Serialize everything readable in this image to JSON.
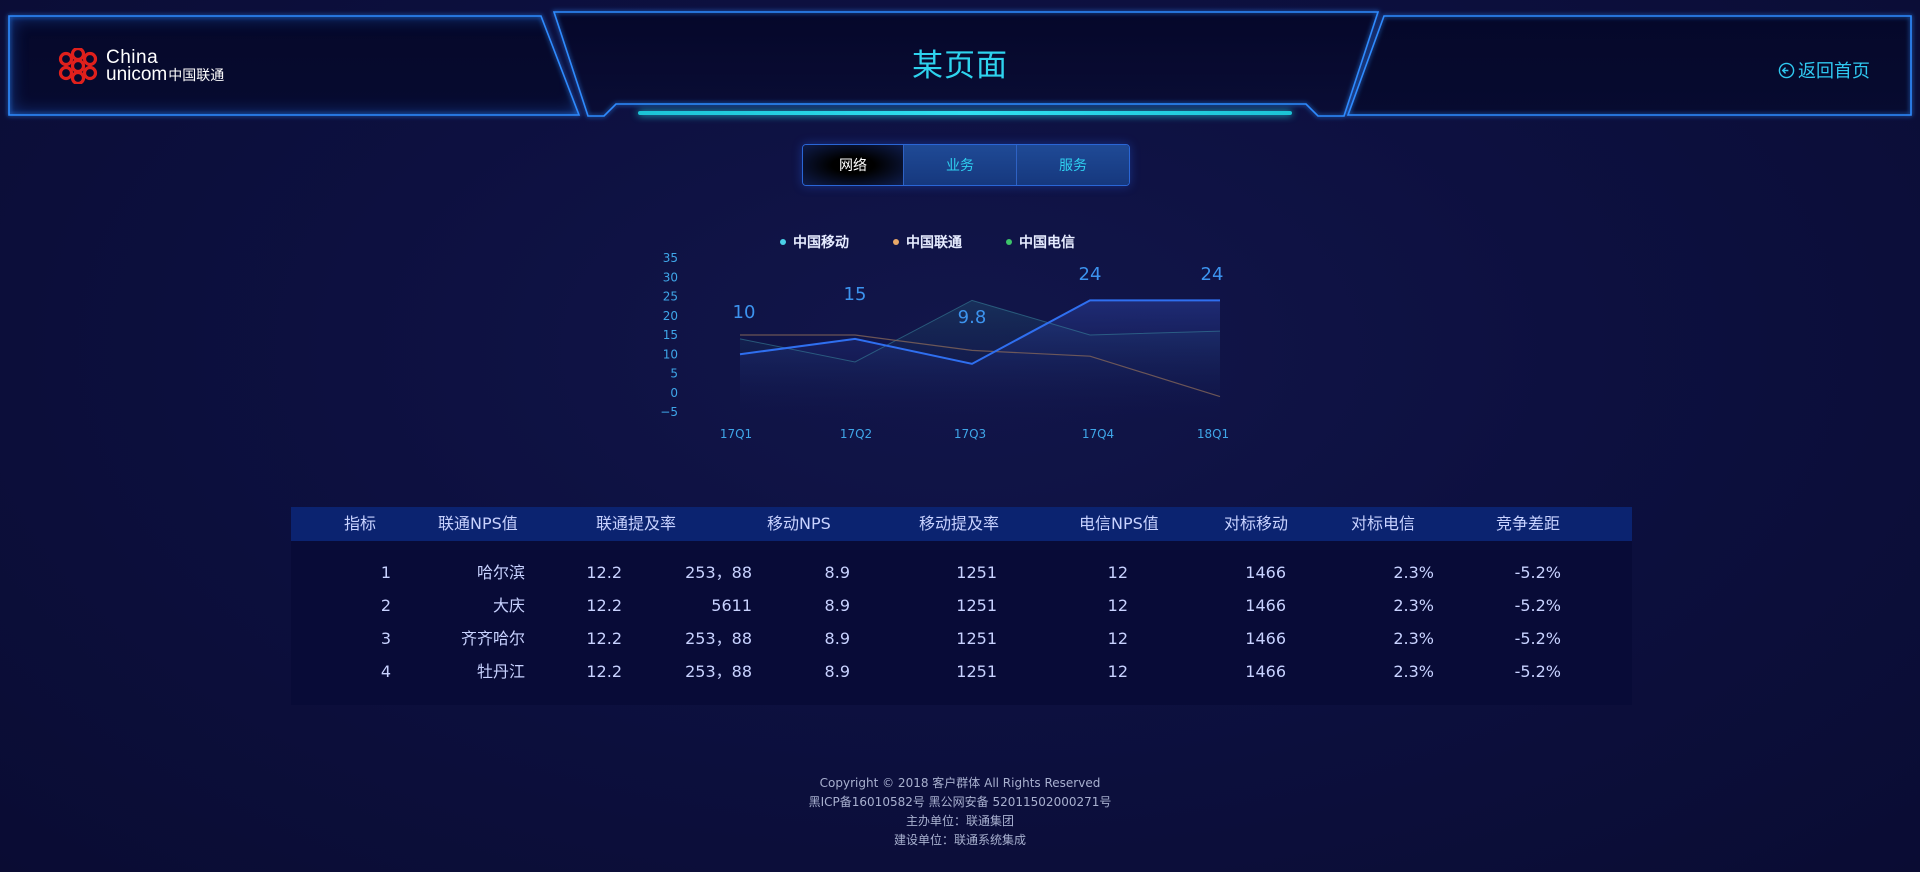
{
  "header": {
    "logo": {
      "line1": "China",
      "line2": "unicom",
      "line2_cn": "中国联通"
    },
    "title": "某页面",
    "back_label": "返回首页"
  },
  "tabs": [
    {
      "label": "网络",
      "active": true
    },
    {
      "label": "业务",
      "active": false
    },
    {
      "label": "服务",
      "active": false
    }
  ],
  "chart_data": {
    "type": "line",
    "categories": [
      "17Q1",
      "17Q2",
      "17Q3",
      "17Q4",
      "18Q1"
    ],
    "yticks": [
      35,
      30,
      25,
      20,
      15,
      10,
      5,
      0,
      -5
    ],
    "ylim": [
      -5,
      35
    ],
    "legend_position": "top-center",
    "series": [
      {
        "name": "中国移动",
        "color": "#4ad0e8",
        "values": [
          14,
          8,
          24,
          15,
          16
        ]
      },
      {
        "name": "中国联通",
        "color": "#e8a868",
        "values": [
          15,
          15,
          11,
          9.5,
          -1
        ]
      },
      {
        "name": "中国电信",
        "color": "#3dc46a",
        "values": [
          10,
          14,
          7.5,
          24,
          24
        ]
      }
    ],
    "data_labels": [
      "10",
      "15",
      "9.8",
      "24",
      "24"
    ]
  },
  "table": {
    "headers": [
      "指标",
      "联通NPS值",
      "联通提及率",
      "移动NPS",
      "移动提及率",
      "电信NPS值",
      "对标移动",
      "对标电信",
      "竞争差距"
    ],
    "rows": [
      [
        "1",
        "哈尔滨",
        "12.2",
        "253，88",
        "8.9",
        "1251",
        "12",
        "1466",
        "2.3%",
        "-5.2%"
      ],
      [
        "2",
        "大庆",
        "12.2",
        "5611",
        "8.9",
        "1251",
        "12",
        "1466",
        "2.3%",
        "-5.2%"
      ],
      [
        "3",
        "齐齐哈尔",
        "12.2",
        "253，88",
        "8.9",
        "1251",
        "12",
        "1466",
        "2.3%",
        "-5.2%"
      ],
      [
        "4",
        "牡丹江",
        "12.2",
        "253，88",
        "8.9",
        "1251",
        "12",
        "1466",
        "2.3%",
        "-5.2%"
      ]
    ]
  },
  "footer": {
    "line1": "Copyright © 2018 客户群体 All Rights Reserved",
    "line2": "黑ICP备16010582号 黑公网安备 52011502000271号",
    "line3": "主办单位：联通集团",
    "line4": "建设单位：联通系统集成"
  }
}
